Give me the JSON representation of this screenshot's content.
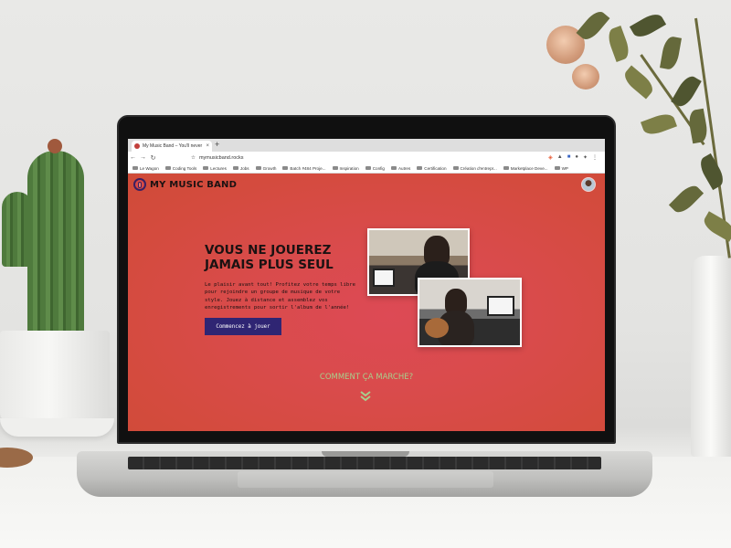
{
  "browser": {
    "tab_title": "My Music Band – You'll never p",
    "tab_close": "×",
    "new_tab": "+",
    "url": "mymusicband.rocks",
    "nav": {
      "back": "←",
      "forward": "→",
      "reload": "↻",
      "home": "⌂",
      "bookmark": "☆"
    },
    "bookmarks": [
      "Le Wagon",
      "Coding Tools",
      "Lectures",
      "Jobs",
      "Growth",
      "Batch #484 Proje...",
      "Inspiration",
      "Config",
      "Autres",
      "Certification",
      "Création d'entrepr...",
      "Marketplace Deve...",
      "WP"
    ]
  },
  "site": {
    "brand": "MY MUSIC BAND",
    "hero": {
      "title": "VOUS NE JOUEREZ JAMAIS PLUS SEUL",
      "text": "Le plaisir avant tout! Profitez votre temps libre pour rejoindre un groupe de musique de votre style. Jouez à distance et assemblez vos enregistrements pour sortir l'album de l'année!",
      "cta": "Commencez à jouer"
    },
    "how_it_works": "COMMENT ÇA MARCHE?",
    "colors": {
      "background": "#d84b47",
      "cta": "#2f2573",
      "how_link": "#a8cf8c",
      "brand_text": "#1b1212"
    }
  }
}
